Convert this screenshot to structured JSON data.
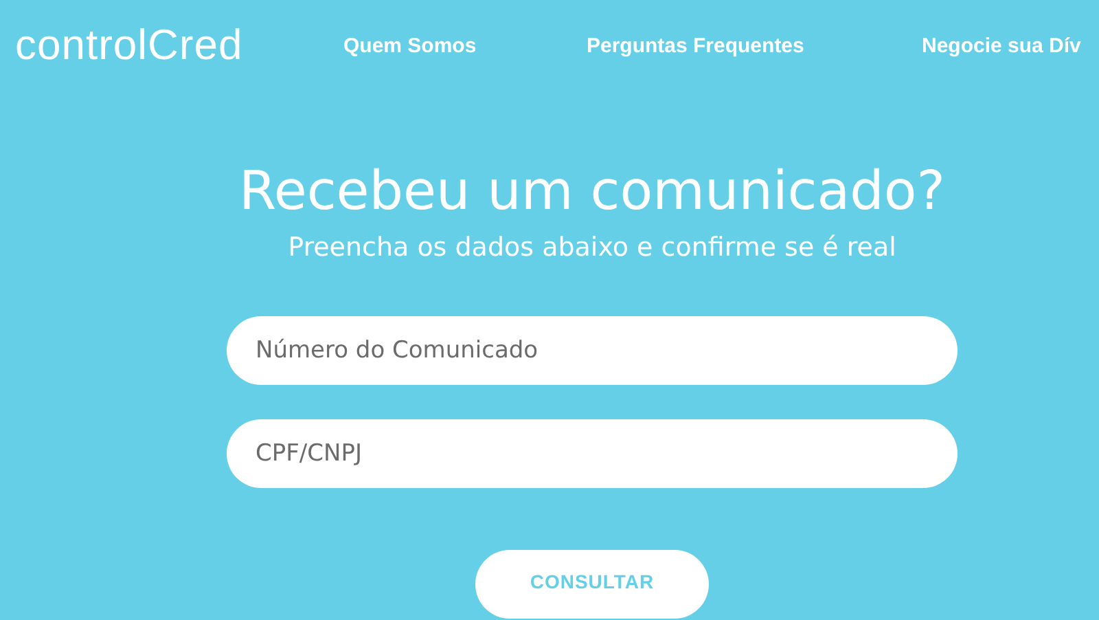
{
  "header": {
    "logo": "controlCred",
    "nav": [
      "Quem Somos",
      "Perguntas Frequentes",
      "Negocie sua Dív"
    ]
  },
  "hero": {
    "title": "Recebeu um comunicado?",
    "subtitle": "Preencha os dados abaixo e confirme se é real"
  },
  "form": {
    "fields": [
      {
        "placeholder": "Número do Comunicado"
      },
      {
        "placeholder": "CPF/CNPJ"
      }
    ],
    "button": "CONSULTAR"
  }
}
